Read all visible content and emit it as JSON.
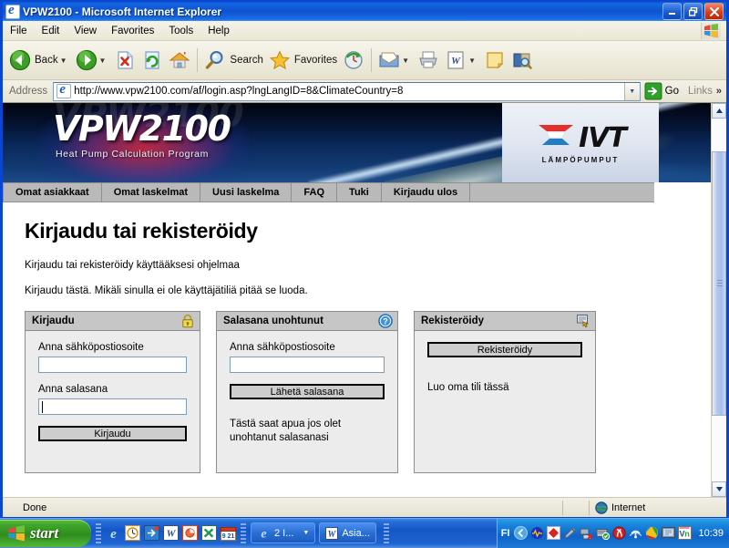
{
  "window": {
    "title": "VPW2100 - Microsoft Internet Explorer",
    "minimize_label": "Minimize",
    "restore_label": "Restore",
    "close_label": "Close"
  },
  "menu": {
    "items": [
      "File",
      "Edit",
      "View",
      "Favorites",
      "Tools",
      "Help"
    ]
  },
  "toolbar": {
    "back": "Back",
    "search": "Search",
    "favorites": "Favorites",
    "icons": [
      "back-icon",
      "forward-icon",
      "stop-icon",
      "refresh-icon",
      "home-icon",
      "search-icon",
      "favorites-icon",
      "history-icon",
      "mail-icon",
      "print-icon",
      "edit-word-icon",
      "notes-icon",
      "research-icon"
    ]
  },
  "address": {
    "label": "Address",
    "url": "http://www.vpw2100.com/af/login.asp?lngLangID=8&ClimateCountry=8",
    "go_label": "Go",
    "links_label": "Links"
  },
  "banner": {
    "title": "VPW2100",
    "subtitle": "Heat Pump Calculation Program",
    "logo_text": "IVT",
    "logo_sub": "LÄMPÖPUMPUT"
  },
  "nav": {
    "items": [
      "Omat asiakkaat",
      "Omat laskelmat",
      "Uusi laskelma",
      "FAQ",
      "Tuki",
      "Kirjaudu ulos"
    ]
  },
  "content": {
    "heading": "Kirjaudu tai rekisteröidy",
    "paragraph1": "Kirjaudu tai rekisteröidy käyttääksesi ohjelmaa",
    "paragraph2": "Kirjaudu tästä. Mikäli sinulla ei ole käyttäjätiliä pitää se luoda."
  },
  "panels": {
    "login": {
      "title": "Kirjaudu",
      "icon": "padlock-icon",
      "email_label": "Anna sähköpostiosoite",
      "email_value": "",
      "password_label": "Anna salasana",
      "password_value": "",
      "submit_label": "Kirjaudu"
    },
    "forgot": {
      "title": "Salasana unohtunut",
      "icon": "help-question-icon",
      "email_label": "Anna sähköpostiosoite",
      "email_value": "",
      "submit_label": "Lähetä salasana",
      "note": "Tästä saat apua jos olet unohtanut salasanasi"
    },
    "register": {
      "title": "Rekisteröidy",
      "icon": "hand-form-icon",
      "submit_label": "Rekisteröidy",
      "note": "Luo oma tili tässä"
    }
  },
  "statusbar": {
    "text": "Done",
    "zone": "Internet",
    "zone_icon": "globe-icon"
  },
  "taskbar": {
    "start_label": "start",
    "tasks": [
      {
        "label": "2 I...",
        "icon": "ie-icon",
        "grouped": true
      },
      {
        "label": "Asia...",
        "icon": "word-icon",
        "grouped": false
      }
    ],
    "language": "FI",
    "clock": "10:39"
  },
  "colors": {
    "titlebar_blue": "#0d52cf",
    "taskbar_blue": "#1457c8",
    "start_green": "#2e8c1c",
    "nav_gray": "#b9b9b9",
    "panel_bg": "#ececec",
    "panel_head": "#c6c6c6"
  }
}
